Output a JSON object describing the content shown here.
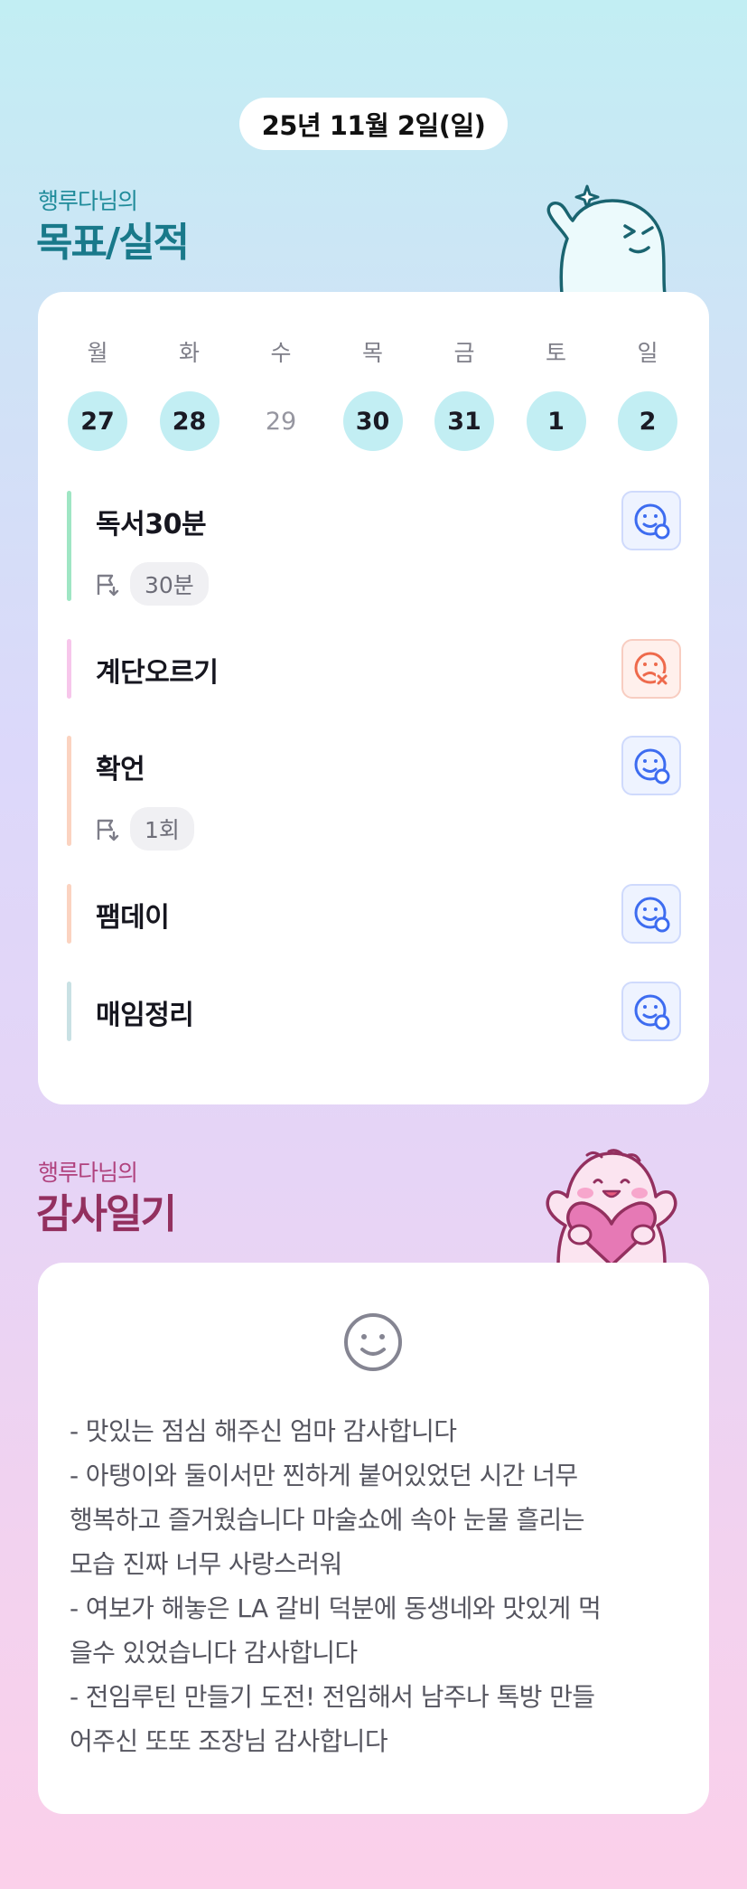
{
  "date": "25년 11월 2일(일)",
  "goals_section": {
    "subtitle": "행루다님의",
    "title": "목표/실적"
  },
  "week": {
    "day_names": [
      "월",
      "화",
      "수",
      "목",
      "금",
      "토",
      "일"
    ],
    "days": [
      {
        "num": "27",
        "done": true
      },
      {
        "num": "28",
        "done": true
      },
      {
        "num": "29",
        "done": false
      },
      {
        "num": "30",
        "done": true
      },
      {
        "num": "31",
        "done": true
      },
      {
        "num": "1",
        "done": true
      },
      {
        "num": "2",
        "done": true
      }
    ]
  },
  "habits": [
    {
      "name": "독서30분",
      "goal": "30분",
      "color": "#9fe6c4",
      "status": "success"
    },
    {
      "name": "계단오르기",
      "goal": null,
      "color": "#f7c6eb",
      "status": "fail"
    },
    {
      "name": "확언",
      "goal": "1회",
      "color": "#fbd3c0",
      "status": "success"
    },
    {
      "name": "팸데이",
      "goal": null,
      "color": "#fbd3c0",
      "status": "success"
    },
    {
      "name": "매임정리",
      "goal": null,
      "color": "#c9e1e4",
      "status": "success"
    }
  ],
  "thanks_section": {
    "subtitle": "행루다님의",
    "title": "감사일기",
    "mood_icon": "smile-face-icon",
    "lines": [
      "- 맛있는 점심 해주신 엄마 감사합니다",
      "- 아탱이와 둘이서만 찐하게 붙어있었던 시간 너무",
      "행복하고 즐거웠습니다 마술쇼에 속아 눈물 흘리는",
      "모습 진짜 너무 사랑스러워",
      "- 여보가 해놓은 LA 갈비 덕분에 동생네와 맛있게 먹",
      "을수 있었습니다 감사합니다",
      "- 전임루틴 만들기 도전! 전임해서 남주나 톡방 만들",
      "어주신 또또 조장님 감사합니다"
    ]
  },
  "colors": {
    "accent_teal": "#19798a",
    "accent_pink": "#93305f",
    "success_blue": "#3d6cf0",
    "fail_red": "#ee6a4c"
  }
}
